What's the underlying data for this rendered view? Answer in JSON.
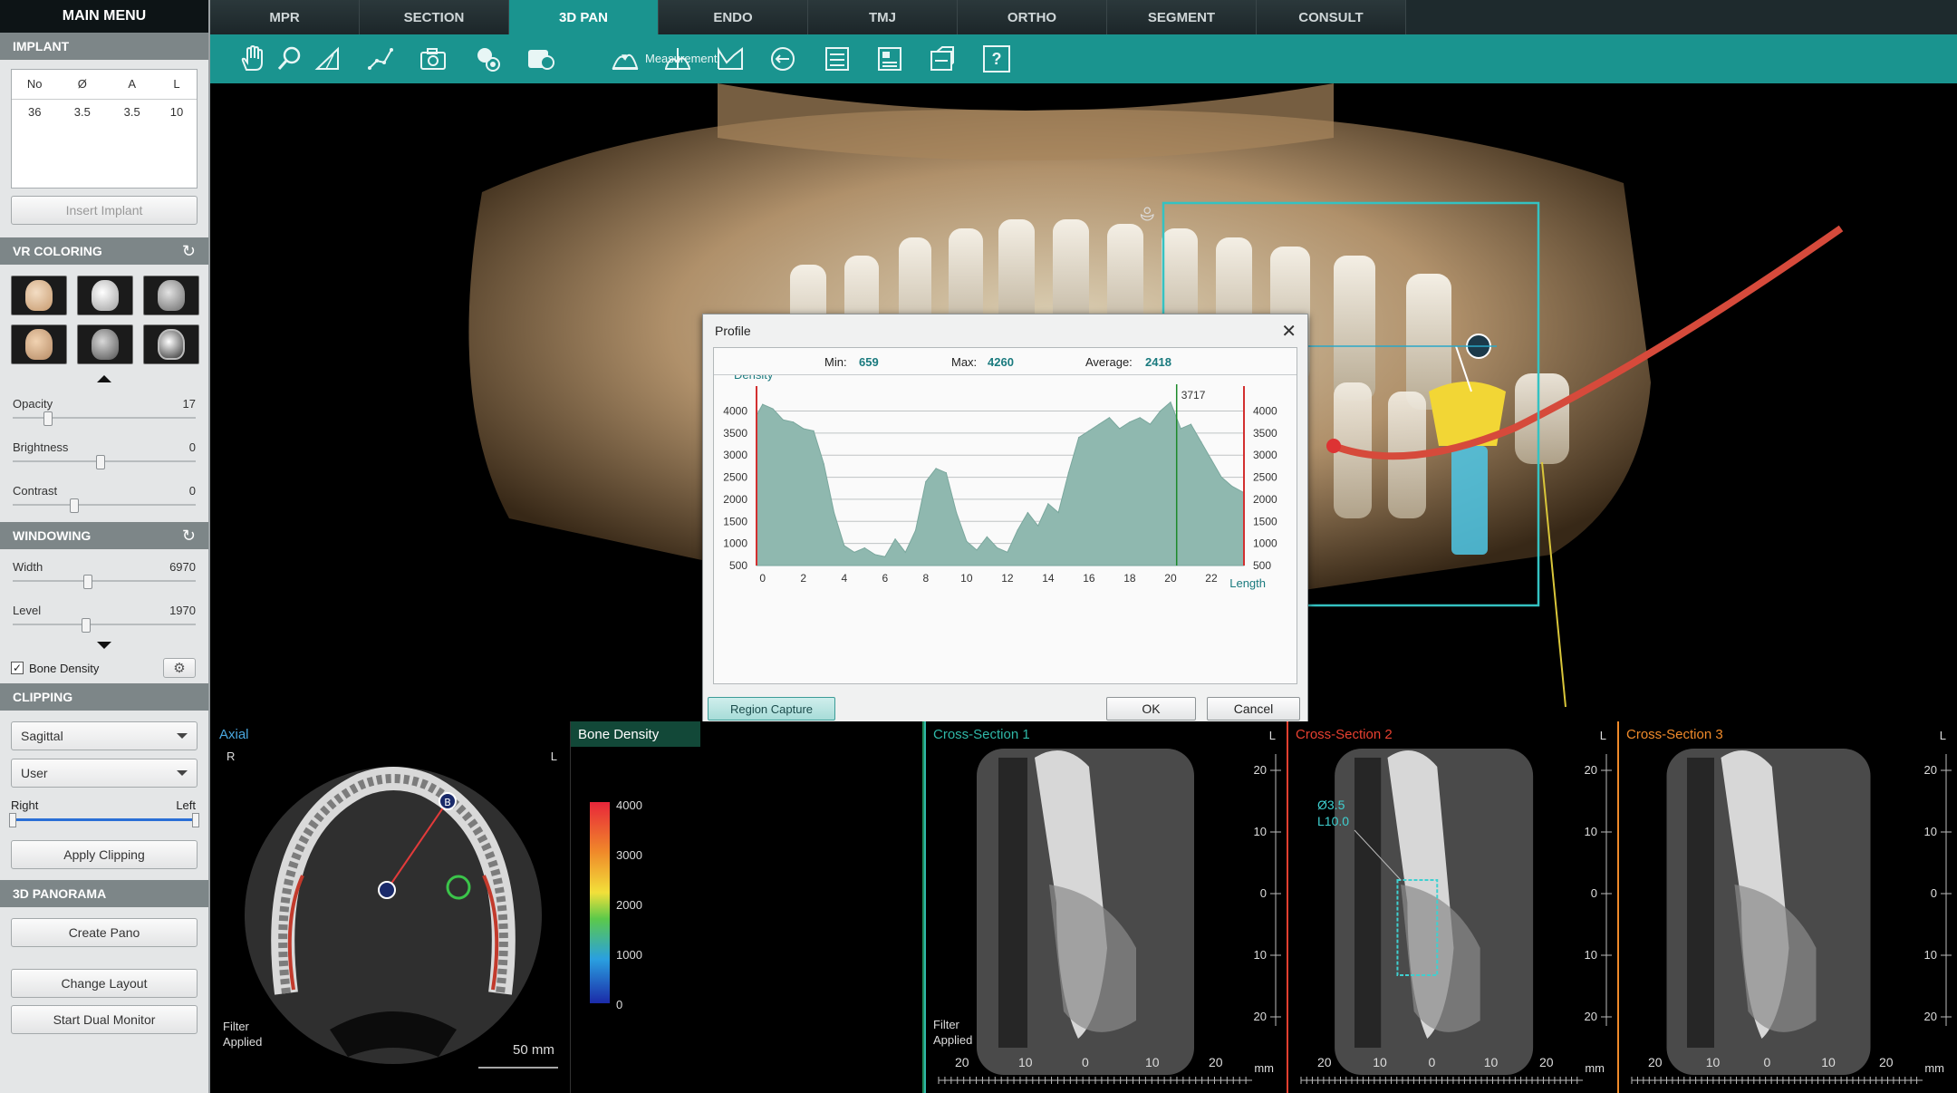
{
  "sidebar": {
    "main_menu": "MAIN MENU",
    "implant": {
      "title": "IMPLANT",
      "columns": [
        "No",
        "Ø",
        "A",
        "L"
      ],
      "rows": [
        [
          "36",
          "3.5",
          "3.5",
          "10"
        ]
      ],
      "insert_button": "Insert Implant"
    },
    "vr_coloring": {
      "title": "VR COLORING",
      "refresh_icon": "refresh-icon"
    },
    "sliders": [
      {
        "label": "Opacity",
        "value": "17",
        "fraction": 0.2
      },
      {
        "label": "Brightness",
        "value": "0",
        "fraction": 0.5
      },
      {
        "label": "Contrast",
        "value": "0",
        "fraction": 0.35
      }
    ],
    "windowing": {
      "title": "WINDOWING",
      "sliders": [
        {
          "label": "Width",
          "value": "6970",
          "fraction": 0.43
        },
        {
          "label": "Level",
          "value": "1970",
          "fraction": 0.42
        }
      ],
      "bone_density_label": "Bone Density",
      "bone_density_checked": true
    },
    "clipping": {
      "title": "CLIPPING",
      "plane": "Sagittal",
      "mode": "User",
      "right_label": "Right",
      "left_label": "Left",
      "apply_button": "Apply Clipping"
    },
    "panorama": {
      "title": "3D PANORAMA",
      "create_button": "Create Pano"
    },
    "change_layout": "Change Layout",
    "dual_monitor": "Start Dual Monitor"
  },
  "tabs": [
    {
      "label": "MPR",
      "active": false
    },
    {
      "label": "SECTION",
      "active": false
    },
    {
      "label": "3D PAN",
      "active": true
    },
    {
      "label": "ENDO",
      "active": false
    },
    {
      "label": "TMJ",
      "active": false
    },
    {
      "label": "ORTHO",
      "active": false
    },
    {
      "label": "SEGMENT",
      "active": false
    },
    {
      "label": "CONSULT",
      "active": false
    }
  ],
  "toolbar": {
    "measurement_label": "Measurement",
    "help_label": "?"
  },
  "profile": {
    "title": "Profile",
    "min_label": "Min:",
    "min": "659",
    "max_label": "Max:",
    "max": "4260",
    "avg_label": "Average:",
    "avg": "2418",
    "marker_value": "3717",
    "region_capture": "Region Capture",
    "ok": "OK",
    "cancel": "Cancel"
  },
  "chart_data": {
    "type": "area",
    "title": "",
    "ylabel": "Density",
    "xlabel": "Length",
    "xlim": [
      -0.3,
      23.6
    ],
    "ylim": [
      500,
      4400
    ],
    "x_ticks": [
      "0",
      "2",
      "4",
      "6",
      "8",
      "10",
      "12",
      "14",
      "16",
      "18",
      "20",
      "22"
    ],
    "y_ticks": [
      "500",
      "1000",
      "1500",
      "2000",
      "2500",
      "3000",
      "3500",
      "4000"
    ],
    "marker_x": 20.3,
    "marker_label": "3717",
    "x": [
      -0.3,
      0,
      0.5,
      1,
      1.5,
      2,
      2.5,
      3,
      3.5,
      4,
      4.5,
      5,
      5.5,
      6,
      6.5,
      7,
      7.5,
      8,
      8.5,
      9,
      9.5,
      10,
      10.5,
      11,
      11.5,
      12,
      12.5,
      13,
      13.5,
      14,
      14.5,
      15,
      15.5,
      16,
      16.5,
      17,
      17.5,
      18,
      18.5,
      19,
      19.5,
      20,
      20.5,
      21,
      21.5,
      22,
      22.5,
      23,
      23.6
    ],
    "values": [
      3900,
      4150,
      4050,
      3800,
      3750,
      3600,
      3550,
      2800,
      1700,
      950,
      800,
      900,
      750,
      700,
      1100,
      800,
      1300,
      2400,
      2700,
      2600,
      1700,
      1050,
      850,
      1150,
      900,
      800,
      1300,
      1700,
      1400,
      1900,
      1700,
      2600,
      3400,
      3550,
      3700,
      3850,
      3600,
      3750,
      3850,
      3700,
      4000,
      4200,
      3600,
      3700,
      3300,
      2900,
      2500,
      2300,
      2150
    ]
  },
  "axial": {
    "title": "Axial",
    "r": "R",
    "l": "L",
    "filter1": "Filter",
    "filter2": "Applied",
    "scale": "50 mm",
    "marker_b": "B"
  },
  "bone_density": {
    "title": "Bone Density",
    "labels": [
      "4000",
      "3000",
      "2000",
      "1000",
      "0"
    ]
  },
  "cross_sections": [
    {
      "title": "Cross-Section 1",
      "color": "#2fb8a8",
      "l": "L",
      "filter1": "Filter",
      "filter2": "Applied",
      "implant": false
    },
    {
      "title": "Cross-Section 2",
      "color": "#e84030",
      "l": "L",
      "implant": true,
      "implant_d": "Ø3.5",
      "implant_l": "L10.0"
    },
    {
      "title": "Cross-Section 3",
      "color": "#f08a2a",
      "l": "L",
      "implant": false
    }
  ],
  "cs_scale": {
    "right_ticks": [
      "20",
      "10",
      "0",
      "10",
      "20"
    ],
    "bottom_ticks": [
      "20",
      "10",
      "0",
      "10",
      "20"
    ],
    "unit": "mm"
  }
}
